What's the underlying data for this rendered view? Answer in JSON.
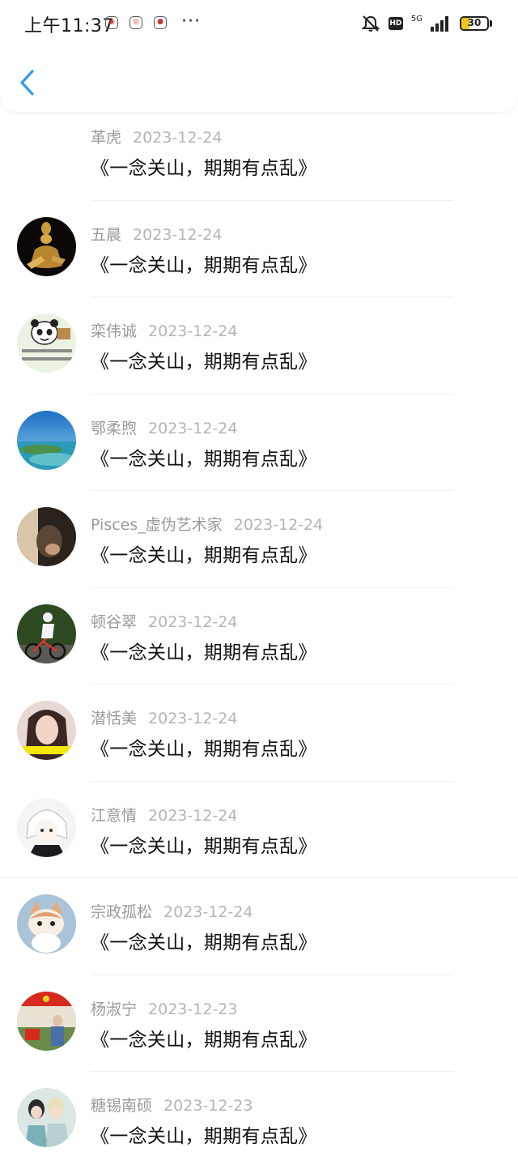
{
  "status_bar": {
    "time": "上午11:37",
    "more": "···",
    "hd": "HD",
    "network": "5G",
    "battery_level": "30",
    "battery_fraction": 0.3
  },
  "nav": {
    "back_icon": "chevron-left-icon",
    "accent_color": "#2f9be8"
  },
  "comments": [
    {
      "name": "革虎",
      "date": "2023-12-24",
      "content": "《一念关山，期期有点乱》",
      "avatar": "none"
    },
    {
      "name": "五晨",
      "date": "2023-12-24",
      "content": "《一念关山，期期有点乱》",
      "avatar": "golden-statue"
    },
    {
      "name": "栾伟诚",
      "date": "2023-12-24",
      "content": "《一念关山，期期有点乱》",
      "avatar": "panda-meme"
    },
    {
      "name": "鄂柔煦",
      "date": "2023-12-24",
      "content": "《一念关山，期期有点乱》",
      "avatar": "sea-island"
    },
    {
      "name": "Pisces_虚伪艺术家",
      "date": "2023-12-24",
      "content": "《一念关山，期期有点乱》",
      "avatar": "dark-portrait"
    },
    {
      "name": "顿谷翠",
      "date": "2023-12-24",
      "content": "《一念关山，期期有点乱》",
      "avatar": "cyclist"
    },
    {
      "name": "潜恬美",
      "date": "2023-12-24",
      "content": "《一念关山，期期有点乱》",
      "avatar": "girl-portrait"
    },
    {
      "name": "江意情",
      "date": "2023-12-24",
      "content": "《一念关山，期期有点乱》",
      "avatar": "anime-character"
    },
    {
      "name": "宗政孤松",
      "date": "2023-12-24",
      "content": "《一念关山，期期有点乱》",
      "avatar": "kitten"
    },
    {
      "name": "杨淑宁",
      "date": "2023-12-23",
      "content": "《一念关山，期期有点乱》",
      "avatar": "flag-photo"
    },
    {
      "name": "糖锡南硕",
      "date": "2023-12-23",
      "content": "《一念关山，期期有点乱》",
      "avatar": "two-people"
    }
  ]
}
